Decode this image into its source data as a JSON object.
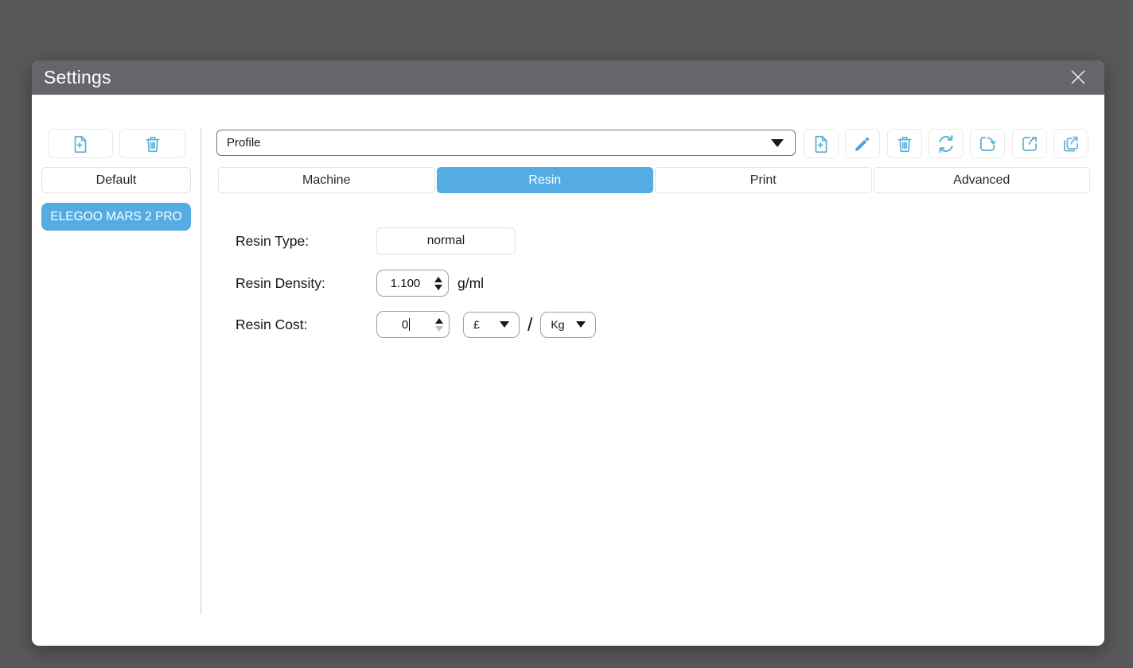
{
  "colors": {
    "accent": "#54ace3",
    "icon_blue": "#5fb0d4",
    "overlay_background": "#59595b",
    "titlebar_background": "#64666a"
  },
  "window": {
    "title": "Settings"
  },
  "sidebar": {
    "action_icons": [
      "add-profile-file-icon",
      "delete-profile-icon"
    ],
    "profiles": [
      {
        "label": "Default",
        "active": false
      },
      {
        "label": "ELEGOO MARS 2 PRO",
        "active": true
      }
    ]
  },
  "toolbar": {
    "profile_select": {
      "value": "Profile"
    },
    "action_icons": [
      "add",
      "edit",
      "delete",
      "refresh",
      "import",
      "export",
      "export-all"
    ]
  },
  "tabs": [
    {
      "label": "Machine",
      "active": false
    },
    {
      "label": "Resin",
      "active": true
    },
    {
      "label": "Print",
      "active": false
    },
    {
      "label": "Advanced",
      "active": false
    }
  ],
  "form": {
    "resin_type": {
      "label": "Resin Type:",
      "value": "normal"
    },
    "resin_density": {
      "label": "Resin Density:",
      "value": "1.100",
      "unit": "g/ml"
    },
    "resin_cost": {
      "label": "Resin Cost:",
      "value": "0",
      "currency": "£",
      "separator": "/",
      "per_unit": "Kg"
    }
  }
}
